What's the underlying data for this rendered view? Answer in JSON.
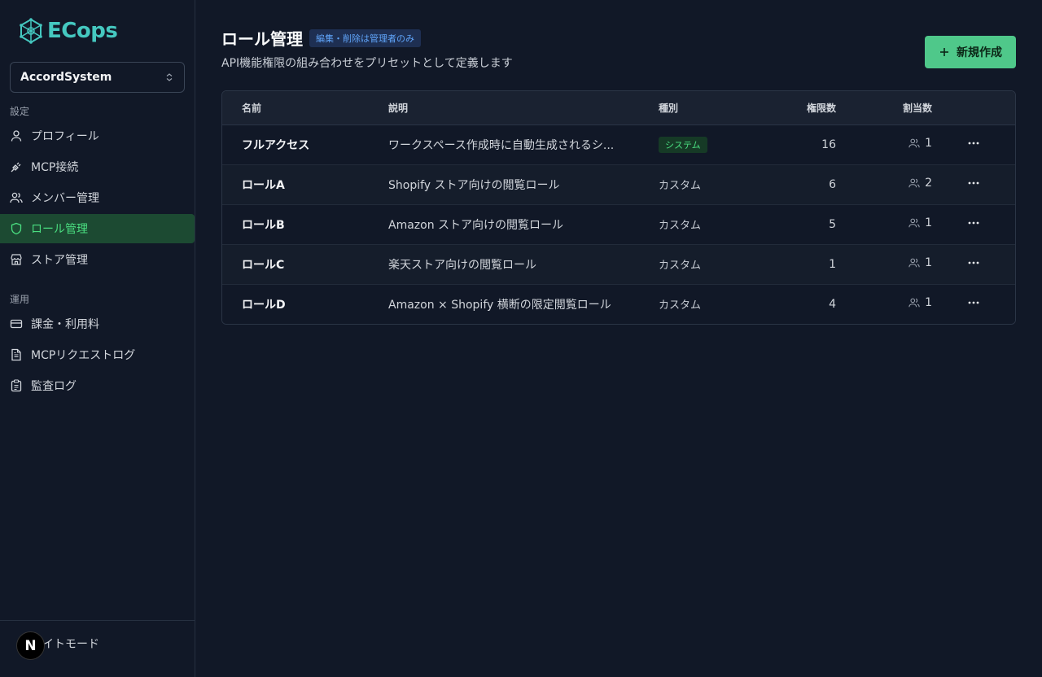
{
  "app": {
    "logo_text": "ECops",
    "accent": "#45c8c0"
  },
  "workspace": {
    "name": "AccordSystem"
  },
  "sidebar": {
    "section_settings": "設定",
    "section_ops": "運用",
    "settings_items": [
      {
        "label": "プロフィール",
        "icon": "user-icon"
      },
      {
        "label": "MCP接続",
        "icon": "plug-icon"
      },
      {
        "label": "メンバー管理",
        "icon": "users-icon"
      },
      {
        "label": "ロール管理",
        "icon": "shield-icon",
        "active": true
      },
      {
        "label": "ストア管理",
        "icon": "store-icon"
      }
    ],
    "ops_items": [
      {
        "label": "課金・利用料",
        "icon": "credit-card-icon"
      },
      {
        "label": "MCPリクエストログ",
        "icon": "file-text-icon"
      },
      {
        "label": "監査ログ",
        "icon": "clipboard-icon"
      }
    ],
    "footer": {
      "light_mode_label": "ライトモード",
      "avatar_letter": "N"
    }
  },
  "header": {
    "title": "ロール管理",
    "badge": "編集・削除は管理者のみ",
    "subtitle": "API機能権限の組み合わせをプリセットとして定義します",
    "new_button": "新規作成"
  },
  "table": {
    "columns": {
      "name": "名前",
      "desc": "説明",
      "kind": "種別",
      "perms": "権限数",
      "assigned": "割当数"
    },
    "rows": [
      {
        "name": "フルアクセス",
        "desc": "ワークスペース作成時に自動生成されるシ...",
        "kind": "システム",
        "system": true,
        "perms": "16",
        "assigned": "1"
      },
      {
        "name": "ロールA",
        "desc": "Shopify ストア向けの閲覧ロール",
        "kind": "カスタム",
        "system": false,
        "perms": "6",
        "assigned": "2"
      },
      {
        "name": "ロールB",
        "desc": "Amazon ストア向けの閲覧ロール",
        "kind": "カスタム",
        "system": false,
        "perms": "5",
        "assigned": "1"
      },
      {
        "name": "ロールC",
        "desc": "楽天ストア向けの閲覧ロール",
        "kind": "カスタム",
        "system": false,
        "perms": "1",
        "assigned": "1"
      },
      {
        "name": "ロールD",
        "desc": "Amazon × Shopify 横断の限定閲覧ロール",
        "kind": "カスタム",
        "system": false,
        "perms": "4",
        "assigned": "1"
      }
    ]
  }
}
